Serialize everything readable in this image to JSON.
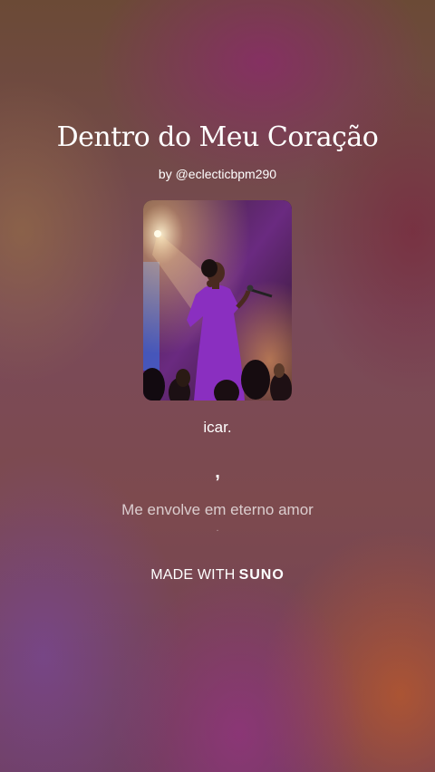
{
  "song": {
    "title": "Dentro do Meu Coração",
    "byline": "by @eclecticbpm290"
  },
  "lyrics": {
    "previous": "icar.",
    "mark": ",",
    "current": "Me envolve em eterno amor",
    "next": "."
  },
  "watermark": {
    "prefix": "MADE WITH",
    "brand": "SUNO"
  },
  "colors": {
    "dress": "#8a2fc0",
    "stage_light": "#ffd9a0",
    "screen_blue": "#3a6ad8"
  }
}
